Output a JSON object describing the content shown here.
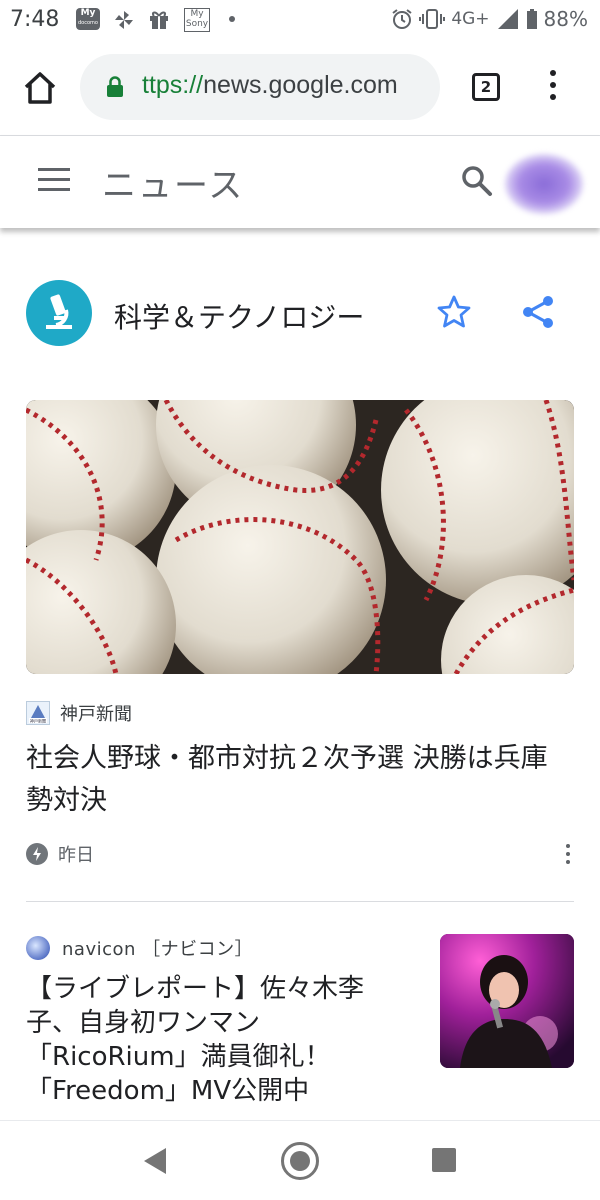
{
  "status_bar": {
    "time": "7:48",
    "left_icons": [
      "my-docomo-icon",
      "pinwheel-icon",
      "gift-icon",
      "my-sony-icon",
      "dot-icon"
    ],
    "my_label": "My",
    "docomo_label": "docomo",
    "sony_label": "My Sony",
    "network": "4G+",
    "battery": "88%"
  },
  "browser": {
    "url_scheme": "ttps://",
    "url_host": "news.google.com",
    "tab_count": "2"
  },
  "news_header": {
    "title": "ニュース"
  },
  "section": {
    "title": "科学＆テクノロジー",
    "icon_color": "#1fa9c7",
    "accent_color": "#4285f4"
  },
  "article1": {
    "source": "神戸新聞",
    "source_logo_text": "神戸新聞",
    "headline": "社会人野球・都市対抗２次予選 決勝は兵庫勢対決",
    "time": "昨日"
  },
  "article2": {
    "source": "navicon ［ナビコン］",
    "headline_lines": [
      "【ライブレポート】佐々木李",
      "子、自身初ワンマン",
      "「RicoRium」満員御礼！",
      "「Freedom」MV公開中"
    ]
  }
}
